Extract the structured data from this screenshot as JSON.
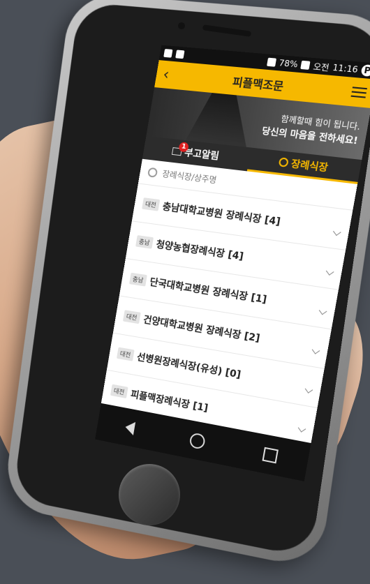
{
  "status_bar": {
    "battery": "78%",
    "time_prefix": "오전",
    "time": "11:16",
    "p_icon": "P"
  },
  "header": {
    "back_icon": "chevron-left",
    "title": "피플맥조문",
    "menu_icon": "hamburger"
  },
  "banner": {
    "line1": "함께할때 힘이 됩니다.",
    "line2": "당신의 마음을 전하세요!"
  },
  "tabs": [
    {
      "label": "부고알림",
      "badge": "1",
      "active": false
    },
    {
      "label": "장례식장",
      "active": true
    }
  ],
  "search": {
    "placeholder": "장례식장/상주명"
  },
  "list": [
    {
      "region": "대전",
      "name": "충남대학교병원 장례식장 [4]"
    },
    {
      "region": "충남",
      "name": "청양농협장례식장 [4]"
    },
    {
      "region": "충남",
      "name": "단국대학교병원 장례식장 [1]"
    },
    {
      "region": "대전",
      "name": "건양대학교병원 장례식장 [2]"
    },
    {
      "region": "대전",
      "name": "선병원장례식장(유성) [0]"
    },
    {
      "region": "대전",
      "name": "피플맥장례식장 [1]"
    }
  ],
  "colors": {
    "accent": "#f6b800",
    "dark": "#2c2c2c"
  }
}
